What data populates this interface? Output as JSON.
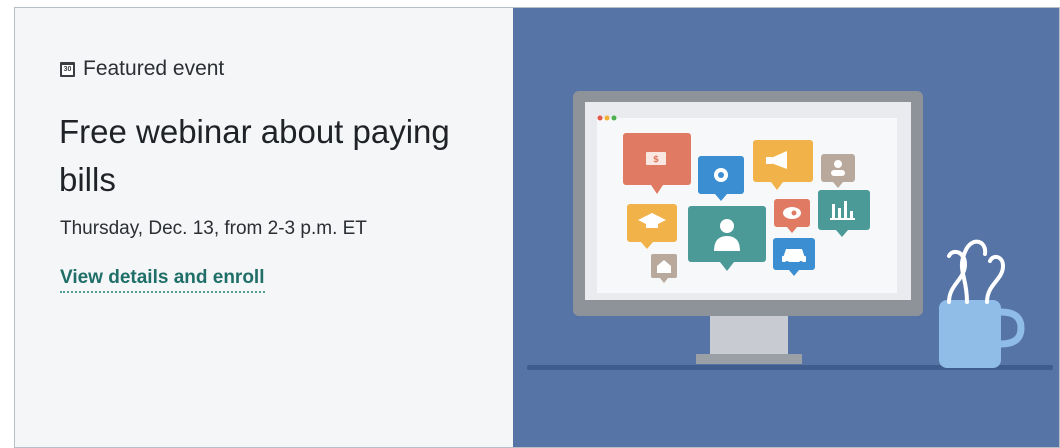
{
  "event": {
    "eyebrow": "Featured event",
    "title": "Free webinar about paying bills",
    "datetime": "Thursday, Dec. 13, from 2-3 p.m. ET",
    "link_text": "View details and enroll"
  },
  "calendar_icon_text": "30",
  "colors": {
    "panel_background": "#f5f6f8",
    "illustration_background": "#5674a6",
    "link": "#1f6f68",
    "monitor_frame": "#8e9399",
    "mug": "#8fbde8"
  },
  "illustration": {
    "icons": [
      "dollar-icon",
      "gear-icon",
      "megaphone-icon",
      "people-icon",
      "graduation-cap-icon",
      "person-icon",
      "piggy-bank-icon",
      "bar-chart-icon",
      "car-icon",
      "house-icon",
      "coffee-mug-icon"
    ]
  }
}
